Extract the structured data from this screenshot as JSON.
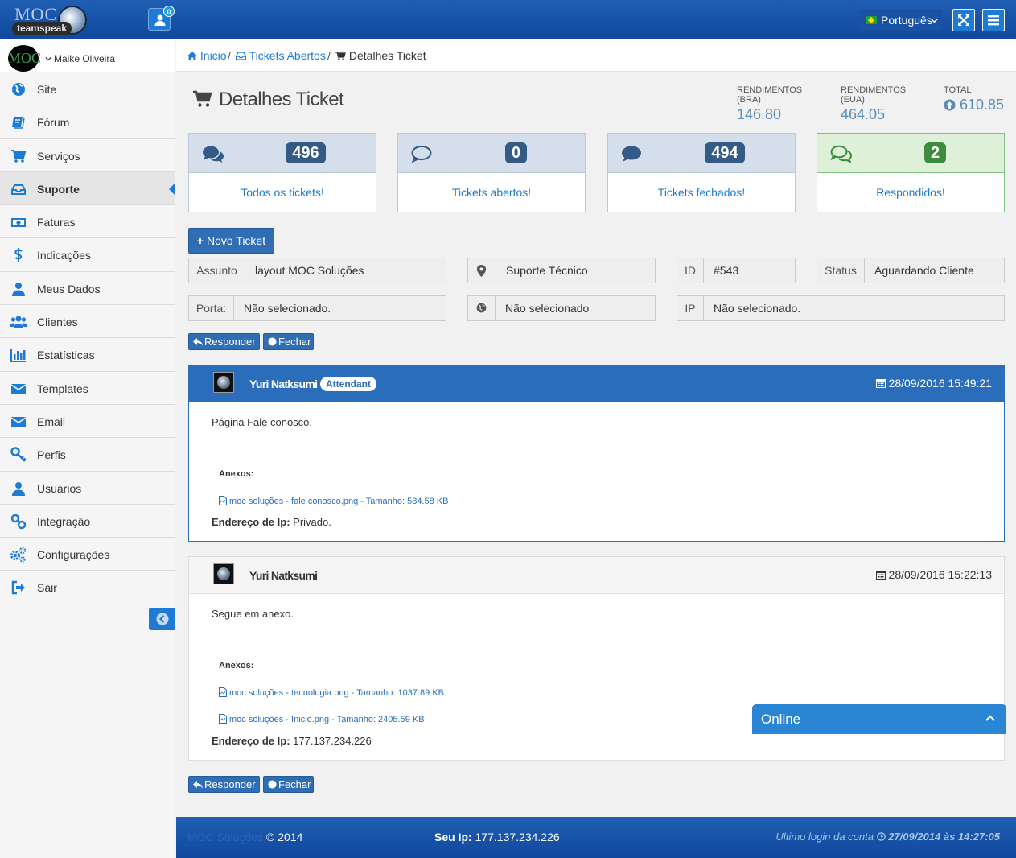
{
  "topbar": {
    "logo_text": "MOC",
    "logo_subtext": "teamspeak",
    "notifications_count": "0",
    "language": "Português"
  },
  "sidebar": {
    "username": "Maike Oliveira",
    "avatar_text": "MOC",
    "items": [
      {
        "label": "Site",
        "icon": "globe-icon"
      },
      {
        "label": "Fórum",
        "icon": "book-icon"
      },
      {
        "label": "Serviços",
        "icon": "cart-icon"
      },
      {
        "label": "Suporte",
        "icon": "inbox-icon",
        "active": true
      },
      {
        "label": "Faturas",
        "icon": "money-icon"
      },
      {
        "label": "Indicações",
        "icon": "dollar-icon"
      },
      {
        "label": "Meus Dados",
        "icon": "user-icon"
      },
      {
        "label": "Clientes",
        "icon": "users-icon"
      },
      {
        "label": "Estatísticas",
        "icon": "bar-chart-icon"
      },
      {
        "label": "Templates",
        "icon": "envelope-icon"
      },
      {
        "label": "Email",
        "icon": "envelope-icon"
      },
      {
        "label": "Perfis",
        "icon": "key-icon"
      },
      {
        "label": "Usuários",
        "icon": "user-icon"
      },
      {
        "label": "Integração",
        "icon": "link-icon"
      },
      {
        "label": "Configurações",
        "icon": "cogs-icon"
      },
      {
        "label": "Sair",
        "icon": "sign-out-icon"
      }
    ]
  },
  "breadcrumb": {
    "home": "Inicio",
    "tickets": "Tickets Abertos",
    "current": "Detalhes Ticket"
  },
  "page": {
    "title": "Detalhes Ticket",
    "stats": [
      {
        "label": "Rendimentos (BRA)",
        "value": "146.80"
      },
      {
        "label": "Rendimentos (EUA)",
        "value": "464.05"
      },
      {
        "label": "Total",
        "value": "610.85"
      }
    ]
  },
  "counters": [
    {
      "count": "496",
      "label": "Todos os tickets!"
    },
    {
      "count": "0",
      "label": "Tickets abertos!"
    },
    {
      "count": "494",
      "label": "Tickets fechados!"
    },
    {
      "count": "2",
      "label": "Respondidos!"
    }
  ],
  "actions": {
    "new_ticket": "Novo Ticket",
    "reply": "Responder",
    "close": "Fechar"
  },
  "ticket": {
    "subject_label": "Assunto",
    "subject": "layout MOC Soluções",
    "department": "Suporte Técnico",
    "id_label": "ID",
    "id": "#543",
    "status_label": "Status",
    "status": "Aguardando Cliente",
    "port_label": "Porta:",
    "port": "Não selecionado.",
    "server": "Não selecionado",
    "ip_label": "IP",
    "ip": "Não selecionado."
  },
  "messages": [
    {
      "author": "Yuri Natksumi",
      "badge": "Attendant",
      "date": "28/09/2016 15:49:21",
      "text": "Página Fale conosco.",
      "attachments_label": "Anexos:",
      "attachments": [
        "moc soluções - fale conosco.png - Tamanho: 584.58 KB"
      ],
      "ip_label": "Endereço de Ip:",
      "ip": "Privado."
    },
    {
      "author": "Yuri Natksumi",
      "date": "28/09/2016 15:22:13",
      "text": "Segue em anexo.",
      "attachments_label": "Anexos:",
      "attachments": [
        "moc soluções - tecnologia.png - Tamanho: 1037.89 KB",
        "moc soluções - Inicio.png - Tamanho: 2405.59 KB"
      ],
      "ip_label": "Endereço de Ip:",
      "ip": "177.137.234.226"
    }
  ],
  "online_widget": {
    "label": "Online"
  },
  "footer": {
    "brand": "MOC Soluções",
    "copyright": "© 2014",
    "ip_label": "Seu Ip:",
    "ip": "177.137.234.226",
    "last_login_label": "Ultimo login da conta",
    "last_login": "27/09/2014 às 14:27:05"
  },
  "colors": {
    "primary": "#1d7bd6",
    "navbar": "#1b56a8",
    "success": "#3d8b3d"
  }
}
